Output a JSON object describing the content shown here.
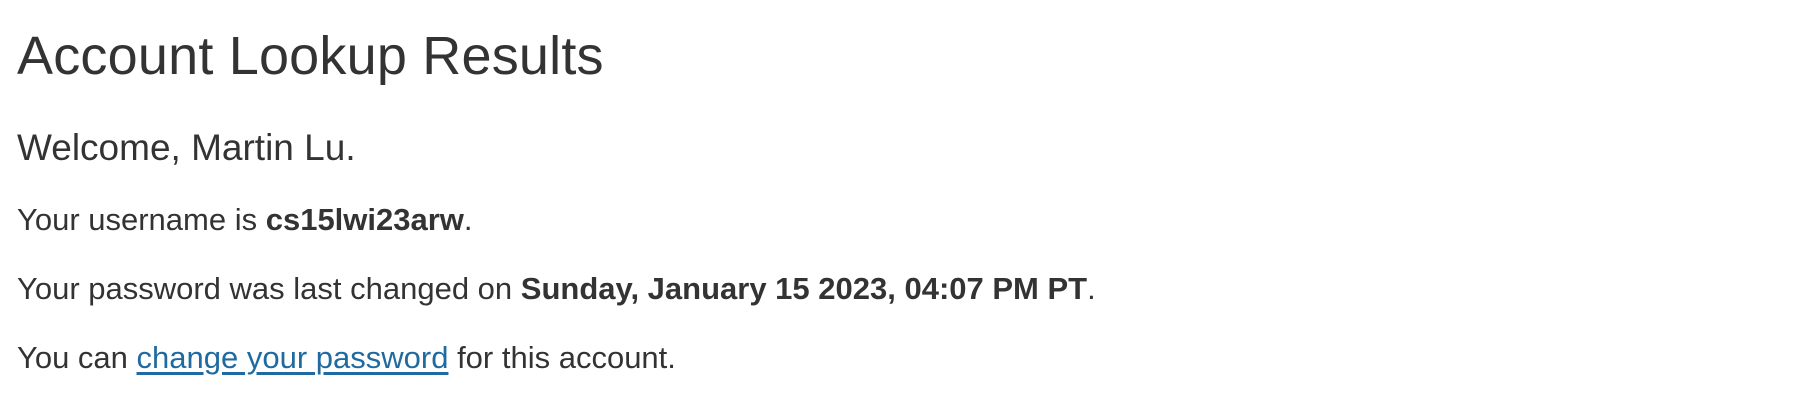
{
  "page": {
    "title": "Account Lookup Results",
    "welcome": "Welcome, Martin Lu.",
    "username_line": {
      "prefix": "Your username is ",
      "username": "cs15lwi23arw",
      "suffix": "."
    },
    "password_line": {
      "prefix": "Your password was last changed on ",
      "changed_on": "Sunday, January 15 2023, 04:07 PM PT",
      "suffix": "."
    },
    "change_line": {
      "prefix": "You can ",
      "link_text": "change your password",
      "suffix": " for this account."
    }
  },
  "colors": {
    "text": "#333333",
    "link": "#1f6aa0",
    "background": "#ffffff"
  }
}
